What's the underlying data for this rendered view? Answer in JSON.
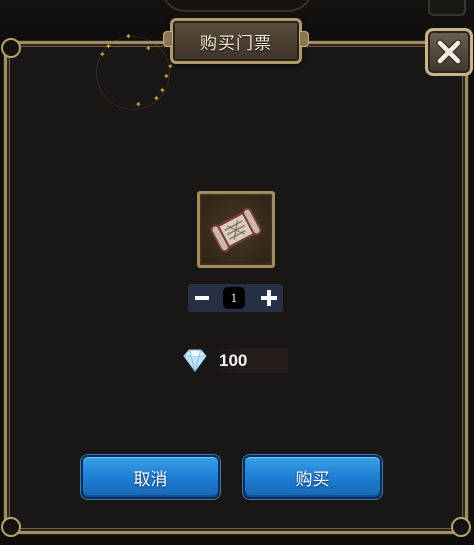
{
  "dialog": {
    "title": "购买门票",
    "item": {
      "icon": "ticket-scroll-icon"
    },
    "quantity": {
      "value": "1",
      "minus_icon": "minus-icon",
      "plus_icon": "plus-icon"
    },
    "price": {
      "currency_icon": "diamond-icon",
      "amount": "100"
    },
    "buttons": {
      "cancel_label": "取消",
      "buy_label": "购买"
    },
    "close_icon": "close-x-icon"
  },
  "colors": {
    "panel_border": "#a08b62",
    "panel_bg": "#181715",
    "button_blue": "#1f7fd3",
    "stepper_bg": "#262f43"
  }
}
